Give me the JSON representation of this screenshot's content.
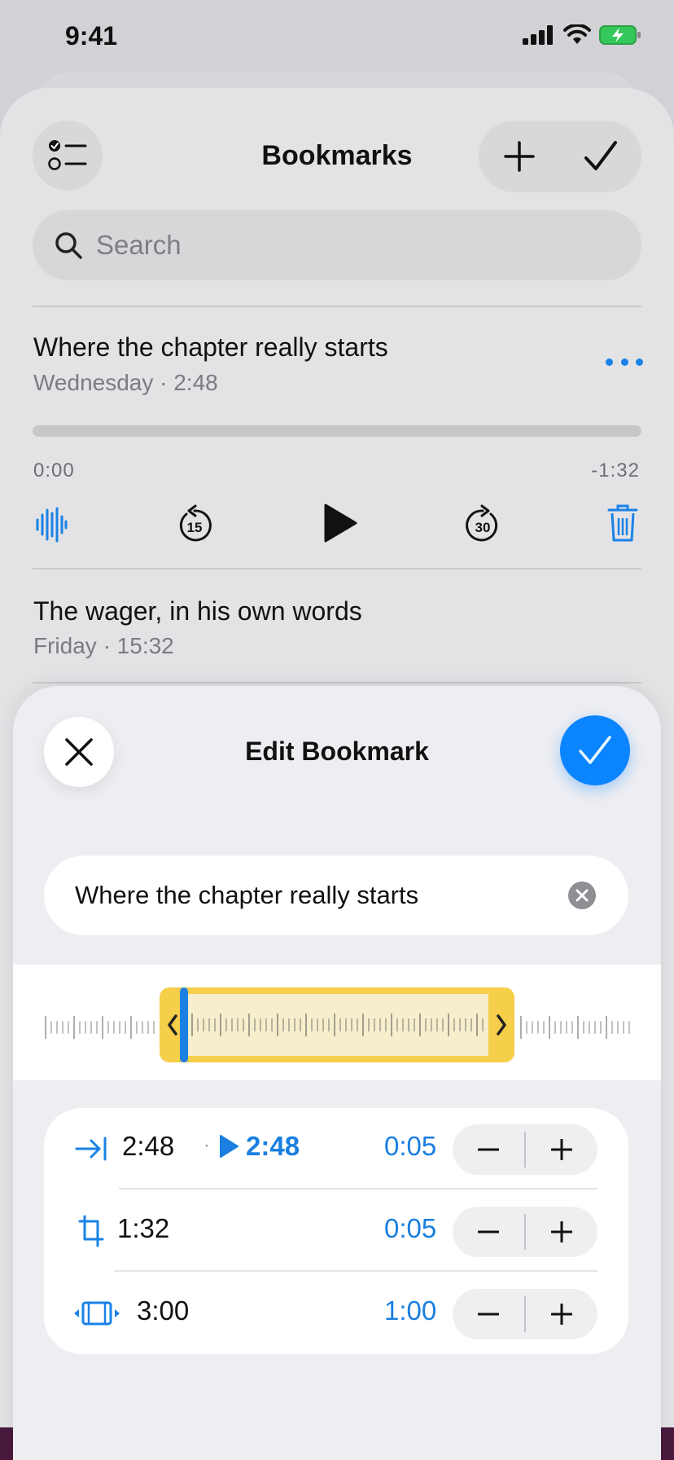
{
  "status_bar": {
    "time": "9:41"
  },
  "bookmarks_screen": {
    "title": "Bookmarks",
    "search": {
      "placeholder": "Search"
    },
    "items": [
      {
        "title": "Where the chapter really starts",
        "subtitle": "Wednesday · 2:48"
      },
      {
        "title": "The wager, in his own words",
        "subtitle": "Friday · 15:32"
      }
    ],
    "player": {
      "elapsed": "0:00",
      "remaining": "-1:32",
      "progress_fraction": 0,
      "skip_back_seconds": "15",
      "skip_forward_seconds": "30"
    }
  },
  "edit_sheet": {
    "title": "Edit Bookmark",
    "name_value": "Where the chapter really starts",
    "rows": [
      {
        "time": "2:48",
        "separator": "·",
        "play_time": "2:48",
        "step": "0:05"
      },
      {
        "time": "1:32",
        "step": "0:05"
      },
      {
        "time": "3:00",
        "step": "1:00"
      }
    ]
  },
  "colors": {
    "accent": "#1a82e6",
    "confirm": "#0a84ff",
    "selection": "#f5ce4a",
    "battery": "#34c759"
  }
}
